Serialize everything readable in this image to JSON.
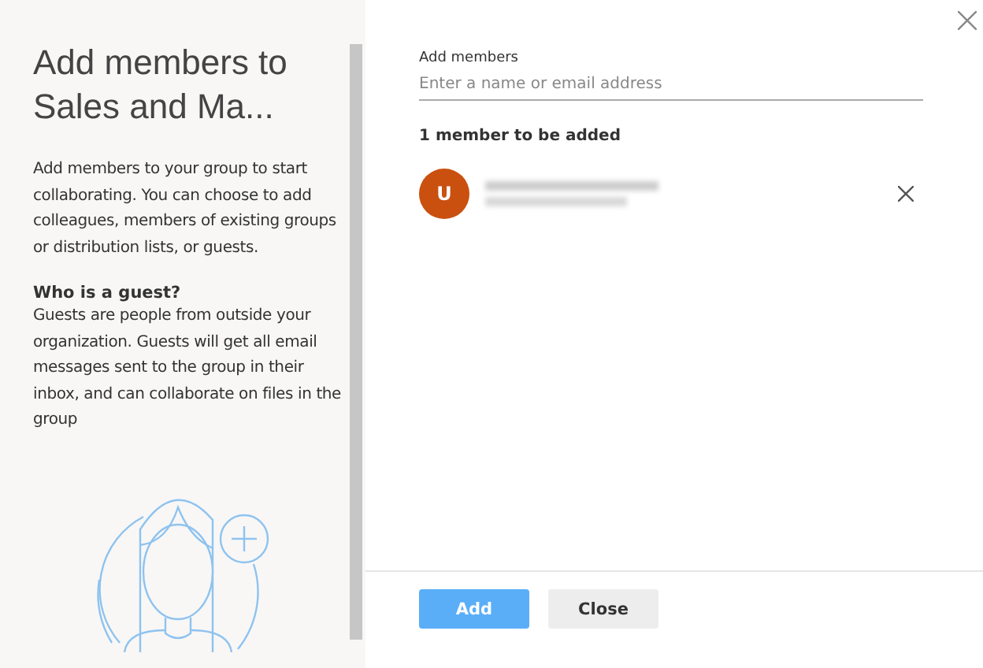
{
  "sidebar": {
    "title": "Add members to Sales and Ma...",
    "description": "Add members to your group to start collaborating. You can choose to add colleagues, members of existing groups or distribution lists, or guests.",
    "guest_heading": "Who is a guest?",
    "guest_text": "Guests are people from outside your organization. Guests will get all email messages sent to the group in their inbox, and can collaborate on files in the group"
  },
  "form": {
    "label": "Add members",
    "placeholder": "Enter a name or email address",
    "count_text": "1 member to be added",
    "members": [
      {
        "initial": "U",
        "color": "#ca5010"
      }
    ]
  },
  "buttons": [
    {
      "label": "Add",
      "kind": "primary"
    },
    {
      "label": "Close",
      "kind": "secondary"
    }
  ]
}
